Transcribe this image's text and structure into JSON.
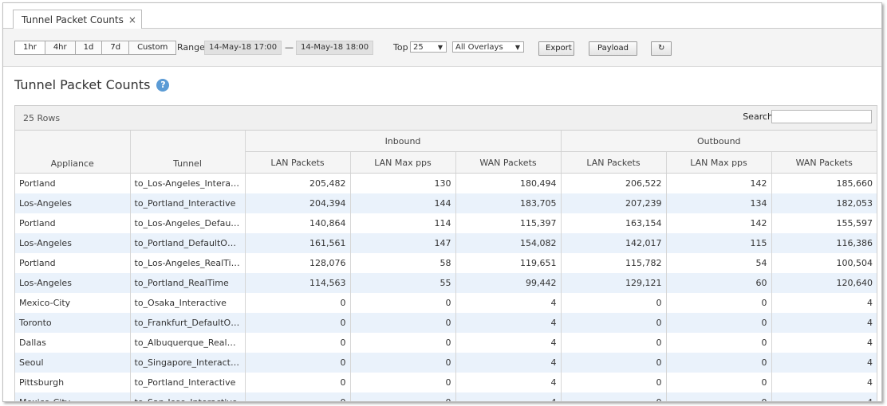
{
  "tab": {
    "label": "Tunnel Packet Counts",
    "close": "×"
  },
  "toolbar": {
    "ranges": [
      "1hr",
      "4hr",
      "1d",
      "7d",
      "Custom"
    ],
    "range_label": "Range",
    "range_start": "14-May-18 17:00",
    "range_sep": "—",
    "range_end": "14-May-18 18:00",
    "top_label": "Top",
    "top_value": "25",
    "overlay_value": "All Overlays",
    "export_label": "Export",
    "payload_label": "Payload",
    "refresh_icon": "↻"
  },
  "page_title": "Tunnel Packet Counts",
  "help_icon": "?",
  "grid": {
    "rows_count": "25 Rows",
    "search_label": "Search",
    "group_inbound": "Inbound",
    "group_outbound": "Outbound",
    "columns": [
      "Appliance",
      "Tunnel",
      "LAN Packets",
      "LAN Max pps",
      "WAN Packets",
      "LAN Packets",
      "LAN Max pps",
      "WAN Packets"
    ],
    "rows": [
      [
        "Portland",
        "to_Los-Angeles_Interactive",
        "205,482",
        "130",
        "180,494",
        "206,522",
        "142",
        "185,660"
      ],
      [
        "Los-Angeles",
        "to_Portland_Interactive",
        "204,394",
        "144",
        "183,705",
        "207,239",
        "134",
        "182,053"
      ],
      [
        "Portland",
        "to_Los-Angeles_DefaultOv...",
        "140,864",
        "114",
        "115,397",
        "163,154",
        "142",
        "155,597"
      ],
      [
        "Los-Angeles",
        "to_Portland_DefaultOverlay",
        "161,561",
        "147",
        "154,082",
        "142,017",
        "115",
        "116,386"
      ],
      [
        "Portland",
        "to_Los-Angeles_RealTime",
        "128,076",
        "58",
        "119,651",
        "115,782",
        "54",
        "100,504"
      ],
      [
        "Los-Angeles",
        "to_Portland_RealTime",
        "114,563",
        "55",
        "99,442",
        "129,121",
        "60",
        "120,640"
      ],
      [
        "Mexico-City",
        "to_Osaka_Interactive",
        "0",
        "0",
        "4",
        "0",
        "0",
        "4"
      ],
      [
        "Toronto",
        "to_Frankfurt_DefaultOverlay",
        "0",
        "0",
        "4",
        "0",
        "0",
        "4"
      ],
      [
        "Dallas",
        "to_Albuquerque_RealTime",
        "0",
        "0",
        "4",
        "0",
        "0",
        "4"
      ],
      [
        "Seoul",
        "to_Singapore_Interactive",
        "0",
        "0",
        "4",
        "0",
        "0",
        "4"
      ],
      [
        "Pittsburgh",
        "to_Portland_Interactive",
        "0",
        "0",
        "4",
        "0",
        "0",
        "4"
      ],
      [
        "Mexico-City",
        "to_San-Jose_Interactive",
        "0",
        "0",
        "4",
        "0",
        "0",
        "4"
      ]
    ]
  },
  "colors": {
    "accent": "#5b9bd5",
    "alt_row": "#eaf2fb"
  }
}
